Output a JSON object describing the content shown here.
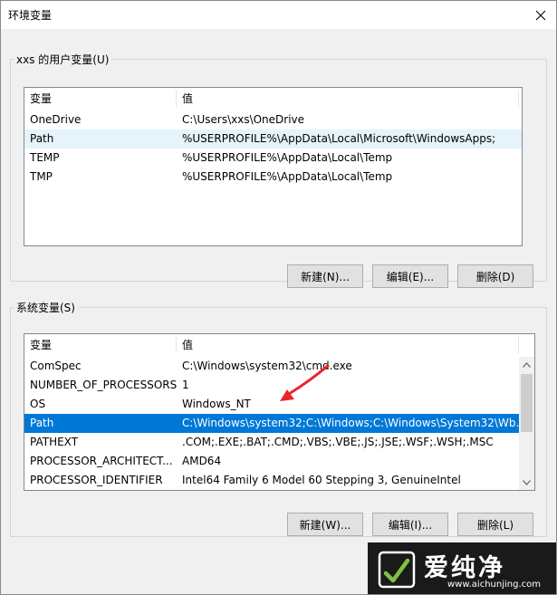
{
  "window": {
    "title": "环境变量"
  },
  "user_vars": {
    "legend": "xxs 的用户变量(U)",
    "columns": [
      "变量",
      "值"
    ],
    "rows": [
      {
        "name": "OneDrive",
        "value": "C:\\Users\\xxs\\OneDrive"
      },
      {
        "name": "Path",
        "value": "%USERPROFILE%\\AppData\\Local\\Microsoft\\WindowsApps;"
      },
      {
        "name": "TEMP",
        "value": "%USERPROFILE%\\AppData\\Local\\Temp"
      },
      {
        "name": "TMP",
        "value": "%USERPROFILE%\\AppData\\Local\\Temp"
      }
    ],
    "buttons": {
      "new": "新建(N)...",
      "edit": "编辑(E)...",
      "delete": "删除(D)"
    }
  },
  "system_vars": {
    "legend": "系统变量(S)",
    "columns": [
      "变量",
      "值"
    ],
    "rows": [
      {
        "name": "ComSpec",
        "value": "C:\\Windows\\system32\\cmd.exe"
      },
      {
        "name": "NUMBER_OF_PROCESSORS",
        "value": "1"
      },
      {
        "name": "OS",
        "value": "Windows_NT"
      },
      {
        "name": "Path",
        "value": "C:\\Windows\\system32;C:\\Windows;C:\\Windows\\System32\\Wb..."
      },
      {
        "name": "PATHEXT",
        "value": ".COM;.EXE;.BAT;.CMD;.VBS;.VBE;.JS;.JSE;.WSF;.WSH;.MSC"
      },
      {
        "name": "PROCESSOR_ARCHITECT...",
        "value": "AMD64"
      },
      {
        "name": "PROCESSOR_IDENTIFIER",
        "value": "Intel64 Family 6 Model 60 Stepping 3, GenuineIntel"
      }
    ],
    "buttons": {
      "new": "新建(W)...",
      "edit": "编辑(I)...",
      "delete": "删除(L)"
    }
  },
  "watermark": {
    "name": "爱纯净",
    "url": "www.aichunjing.com"
  },
  "colors": {
    "selection": "#0078d7",
    "hover": "#e5f3fb",
    "arrow": "#e8282b"
  }
}
